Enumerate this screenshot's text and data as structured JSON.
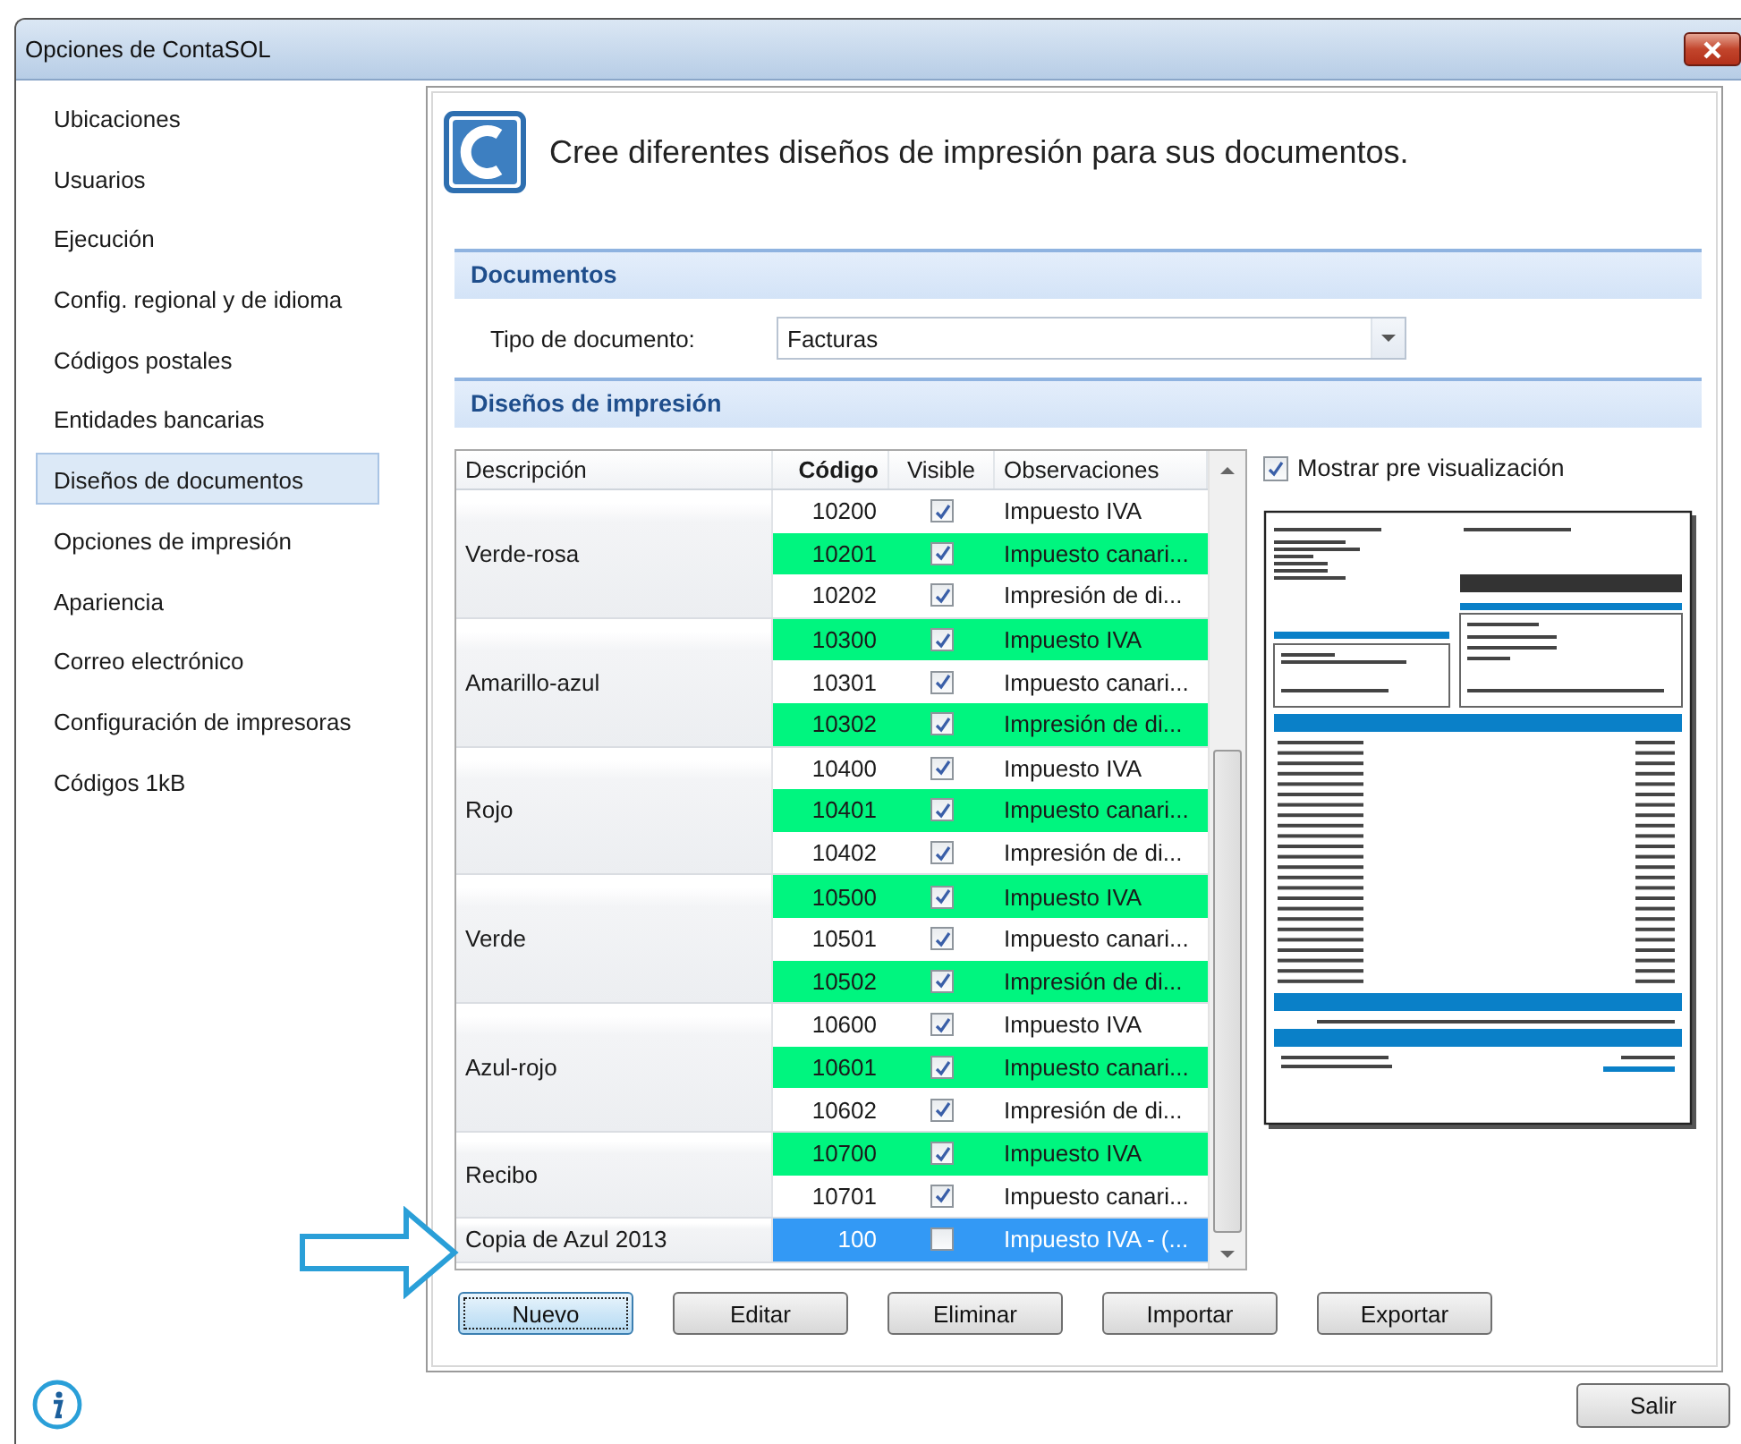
{
  "window": {
    "title": "Opciones de ContaSOL"
  },
  "sidebar": {
    "items": [
      {
        "label": "Ubicaciones",
        "selected": false
      },
      {
        "label": "Usuarios",
        "selected": false
      },
      {
        "label": "Ejecución",
        "selected": false
      },
      {
        "label": "Config. regional y de idioma",
        "selected": false
      },
      {
        "label": "Códigos postales",
        "selected": false
      },
      {
        "label": "Entidades bancarias",
        "selected": false
      },
      {
        "label": "Diseños de documentos",
        "selected": true
      },
      {
        "label": "Opciones de impresión",
        "selected": false
      },
      {
        "label": "Apariencia",
        "selected": false
      },
      {
        "label": "Correo electrónico",
        "selected": false
      },
      {
        "label": "Configuración de impresoras",
        "selected": false
      },
      {
        "label": "Códigos 1kB",
        "selected": false
      }
    ]
  },
  "header": {
    "text": "Cree diferentes diseños de impresión para sus documentos."
  },
  "documents_section": {
    "title": "Documentos",
    "document_type": {
      "label": "Tipo de documento:",
      "value": "Facturas"
    }
  },
  "designs_section": {
    "title": "Diseños de impresión",
    "table": {
      "columns": [
        "Descripción",
        "Código",
        "Visible",
        "Observaciones"
      ],
      "groups": [
        {
          "description": "Verde-rosa",
          "lines": [
            {
              "code": "10200",
              "visible": true,
              "observations": "Impuesto IVA",
              "highlighted": false,
              "selected": false
            },
            {
              "code": "10201",
              "visible": true,
              "observations": "Impuesto canari...",
              "highlighted": true,
              "selected": false
            },
            {
              "code": "10202",
              "visible": true,
              "observations": "Impresión de di...",
              "highlighted": false,
              "selected": false
            }
          ]
        },
        {
          "description": "Amarillo-azul",
          "lines": [
            {
              "code": "10300",
              "visible": true,
              "observations": "Impuesto IVA",
              "highlighted": true,
              "selected": false
            },
            {
              "code": "10301",
              "visible": true,
              "observations": "Impuesto canari...",
              "highlighted": false,
              "selected": false
            },
            {
              "code": "10302",
              "visible": true,
              "observations": "Impresión de di...",
              "highlighted": true,
              "selected": false
            }
          ]
        },
        {
          "description": "Rojo",
          "lines": [
            {
              "code": "10400",
              "visible": true,
              "observations": "Impuesto IVA",
              "highlighted": false,
              "selected": false
            },
            {
              "code": "10401",
              "visible": true,
              "observations": "Impuesto canari...",
              "highlighted": true,
              "selected": false
            },
            {
              "code": "10402",
              "visible": true,
              "observations": "Impresión de di...",
              "highlighted": false,
              "selected": false
            }
          ]
        },
        {
          "description": "Verde",
          "lines": [
            {
              "code": "10500",
              "visible": true,
              "observations": "Impuesto IVA",
              "highlighted": true,
              "selected": false
            },
            {
              "code": "10501",
              "visible": true,
              "observations": "Impuesto canari...",
              "highlighted": false,
              "selected": false
            },
            {
              "code": "10502",
              "visible": true,
              "observations": "Impresión de di...",
              "highlighted": true,
              "selected": false
            }
          ]
        },
        {
          "description": "Azul-rojo",
          "lines": [
            {
              "code": "10600",
              "visible": true,
              "observations": "Impuesto IVA",
              "highlighted": false,
              "selected": false
            },
            {
              "code": "10601",
              "visible": true,
              "observations": "Impuesto canari...",
              "highlighted": true,
              "selected": false
            },
            {
              "code": "10602",
              "visible": true,
              "observations": "Impresión de di...",
              "highlighted": false,
              "selected": false
            }
          ]
        },
        {
          "description": "Recibo",
          "lines": [
            {
              "code": "10700",
              "visible": true,
              "observations": "Impuesto IVA",
              "highlighted": true,
              "selected": false
            },
            {
              "code": "10701",
              "visible": true,
              "observations": "Impuesto canari...",
              "highlighted": false,
              "selected": false
            }
          ]
        },
        {
          "description": "Copia de Azul 2013",
          "lines": [
            {
              "code": "100",
              "visible": false,
              "observations": "Impuesto IVA - (...",
              "highlighted": false,
              "selected": true
            }
          ]
        }
      ]
    },
    "preview": {
      "label": "Mostrar pre visualización",
      "checked": true
    },
    "buttons": [
      {
        "label": "Nuevo",
        "focused": true
      },
      {
        "label": "Editar",
        "focused": false
      },
      {
        "label": "Eliminar",
        "focused": false
      },
      {
        "label": "Importar",
        "focused": false
      },
      {
        "label": "Exportar",
        "focused": false
      }
    ]
  },
  "footer": {
    "buttons": [
      "Salir"
    ]
  }
}
